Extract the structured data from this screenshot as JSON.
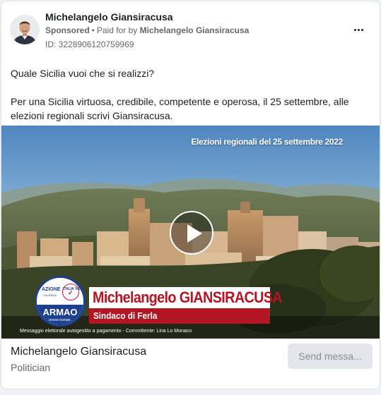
{
  "post": {
    "page_name": "Michelangelo Giansiracusa",
    "sponsored_label": "Sponsored",
    "separator": "•",
    "paid_for_label": "Paid for by",
    "payer_name": "Michelangelo Giansiracusa",
    "ad_id": "ID: 3228906120759969",
    "more_icon": "more-horizontal-icon",
    "body_paragraphs": [
      "Quale Sicilia vuoi che si realizzi?",
      "Per una Sicilia virtuosa, credibile, competente e operosa, il 25 settembre, alle elezioni regionali scrivi Giansiracusa."
    ]
  },
  "video": {
    "caption": "Elezioni regionali del 25 settembre 2022",
    "play_icon": "play-icon",
    "logo": {
      "azione": "AZIONE",
      "calenda": "CALENDA",
      "italia": "ITALIA VIVA",
      "italia_mark": "✓",
      "armao": "ARMAO",
      "europa": "renew europe."
    },
    "banner_name": "Michelangelo GIANSIRACUSA",
    "banner_role": "Sindaco di Ferla",
    "disclaimer": "Messaggio elettorale autogestito a pagamento - Committente: Lina Lo Monaco"
  },
  "footer": {
    "name": "Michelangelo Giansiracusa",
    "category": "Politician",
    "send_button": "Send messa..."
  },
  "colors": {
    "banner_red": "#b31623",
    "party_blue": "#1d3f8f",
    "muted_text": "#65676b"
  }
}
